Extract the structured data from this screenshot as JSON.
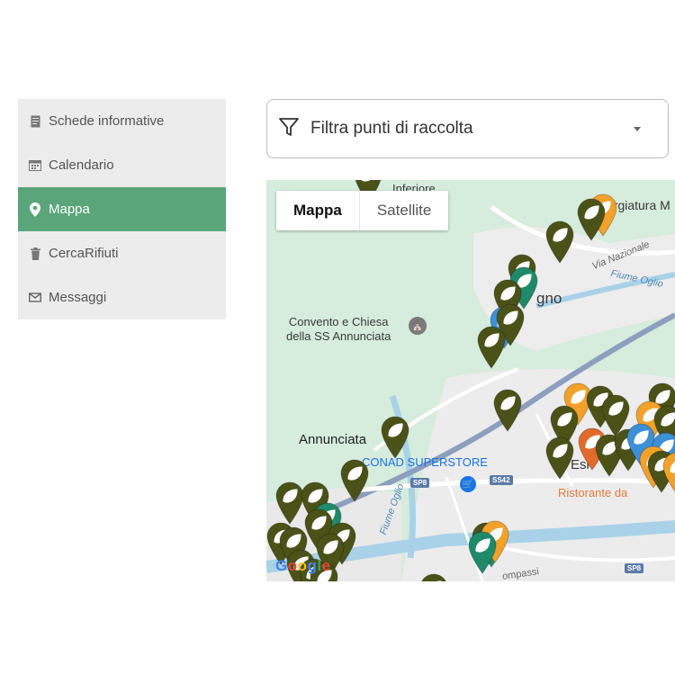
{
  "sidebar": {
    "items": [
      {
        "label": "Schede informative",
        "icon": "document-icon"
      },
      {
        "label": "Calendario",
        "icon": "calendar-icon"
      },
      {
        "label": "Mappa",
        "icon": "map-pin-icon"
      },
      {
        "label": "CercaRifiuti",
        "icon": "trash-icon"
      },
      {
        "label": "Messaggi",
        "icon": "mail-icon"
      }
    ],
    "active_color": "#5aa57a"
  },
  "filter": {
    "label": "Filtra punti di raccolta",
    "icon": "filter-icon"
  },
  "map": {
    "tabs": [
      {
        "label": "Mappa"
      },
      {
        "label": "Satellite"
      }
    ],
    "labels": {
      "convent": "Convento e Chiesa\ndella SS Annunciata",
      "annunciata": "Annunciata",
      "conad": "CONAD SUPERSTORE",
      "ristorante": "Ristorante da",
      "fiume_oglio_north": "Fiume Oglio",
      "fiume_oglio_south": "Fiume Oglio",
      "via_nazionale": "Via Nazionale",
      "esine": "Esi",
      "gno": "gno",
      "forgiatura": "orgiatura M",
      "inferiore": "Inferiore",
      "compassi": "ompassi",
      "ss42": "SS42",
      "sp8_left": "SP8",
      "sp8_right": "SP8"
    },
    "google": "Google",
    "colors": {
      "marker_green": "#4a5218",
      "marker_orange": "#f2a12a",
      "marker_teal": "#1f8a6a",
      "marker_blue": "#3d8fd6",
      "marker_red": "#e06b2b"
    }
  }
}
